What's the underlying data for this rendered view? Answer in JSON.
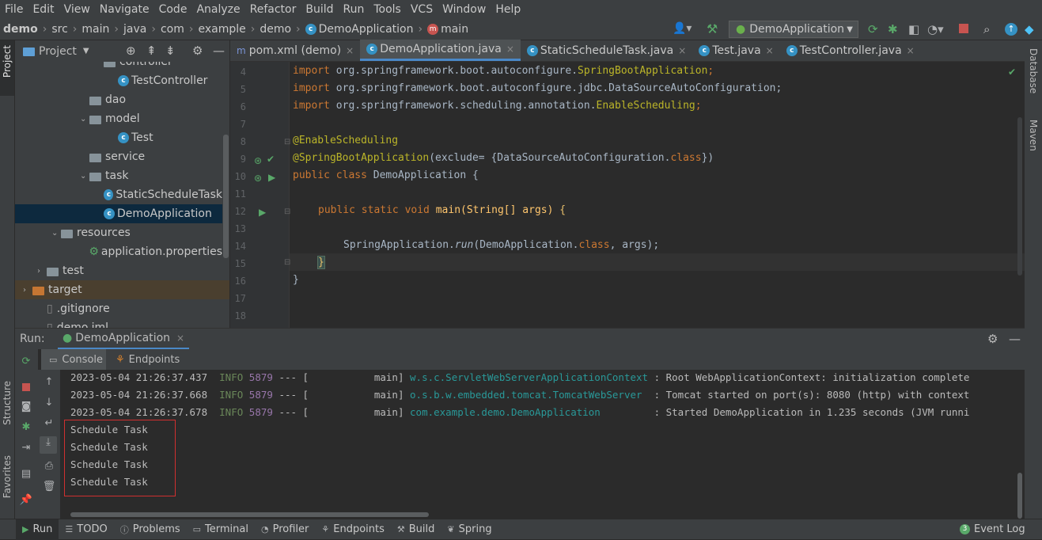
{
  "menu": [
    "File",
    "Edit",
    "View",
    "Navigate",
    "Code",
    "Analyze",
    "Refactor",
    "Build",
    "Run",
    "Tools",
    "VCS",
    "Window",
    "Help"
  ],
  "breadcrumb": [
    "demo",
    "src",
    "main",
    "java",
    "com",
    "example",
    "demo",
    "DemoApplication",
    "main"
  ],
  "run_config": "DemoApplication",
  "project": {
    "title": "Project",
    "tree": [
      {
        "label": "controller",
        "indent": 112,
        "type": "folder"
      },
      {
        "label": "TestController",
        "indent": 112,
        "type": "class"
      },
      {
        "label": "dao",
        "indent": 94,
        "type": "folder"
      },
      {
        "label": "model",
        "indent": 94,
        "type": "folder-open"
      },
      {
        "label": "Test",
        "indent": 112,
        "type": "class"
      },
      {
        "label": "service",
        "indent": 94,
        "type": "folder"
      },
      {
        "label": "task",
        "indent": 94,
        "type": "folder-open"
      },
      {
        "label": "StaticScheduleTask",
        "indent": 112,
        "type": "class"
      },
      {
        "label": "DemoApplication",
        "indent": 94,
        "type": "spring"
      },
      {
        "label": "resources",
        "indent": 58,
        "type": "folder-open"
      },
      {
        "label": "application.properties",
        "indent": 76,
        "type": "props"
      },
      {
        "label": "test",
        "indent": 40,
        "type": "folder-closed"
      },
      {
        "label": "target",
        "indent": 22,
        "type": "folder-orange"
      },
      {
        "label": ".gitignore",
        "indent": 22,
        "type": "file"
      },
      {
        "label": "demo.iml",
        "indent": 22,
        "type": "file"
      }
    ]
  },
  "tabs": [
    {
      "label": "pom.xml (demo)",
      "icon": "m"
    },
    {
      "label": "DemoApplication.java",
      "icon": "c",
      "active": true
    },
    {
      "label": "StaticScheduleTask.java",
      "icon": "c"
    },
    {
      "label": "Test.java",
      "icon": "c"
    },
    {
      "label": "TestController.java",
      "icon": "c"
    }
  ],
  "line_numbers": [
    "4",
    "5",
    "6",
    "7",
    "8",
    "9",
    "10",
    "11",
    "12",
    "13",
    "14",
    "15",
    "16",
    "17",
    "18"
  ],
  "code": {
    "l4_kw": "import ",
    "l4_pkg": "org.springframework.boot.autoconfigure.",
    "l4_an": "SpringBootApplication",
    "l4_end": ";",
    "l5_kw": "import ",
    "l5_rest": "org.springframework.boot.autoconfigure.jdbc.DataSourceAutoConfiguration;",
    "l6_kw": "import ",
    "l6_pkg": "org.springframework.scheduling.annotation.",
    "l6_an": "EnableScheduling",
    "l6_end": ";",
    "l8": "@EnableScheduling",
    "l9_an": "@SpringBootApplication",
    "l9_a": "(exclude= {DataSourceAutoConfiguration.",
    "l9_kw": "class",
    "l9_b": "})",
    "l10_kw": "public class ",
    "l10_rest": "DemoApplication {",
    "l12_kw": "public static void ",
    "l12_rest": "main(String[] args) ",
    "l12_brace": "{",
    "l14_a": "SpringApplication.",
    "l14_run": "run",
    "l14_b": "(DemoApplication.",
    "l14_kw": "class",
    "l14_c": ", args);",
    "l15": "}",
    "l16": "}"
  },
  "run_panel": {
    "label": "Run:",
    "config": "DemoApplication",
    "tabs": [
      "Console",
      "Endpoints"
    ]
  },
  "console": [
    {
      "ts": "2023-05-04 21:26:37.437",
      "level": "INFO",
      "pid": "5879",
      "mid": "--- [           main]",
      "cls": "w.s.c.ServletWebServerApplicationContext",
      "msg": " : Root WebApplicationContext: initialization complete"
    },
    {
      "ts": "2023-05-04 21:26:37.668",
      "level": "INFO",
      "pid": "5879",
      "mid": "--- [           main]",
      "cls": "o.s.b.w.embedded.tomcat.TomcatWebServer ",
      "msg": " : Tomcat started on port(s): 8080 (http) with context"
    },
    {
      "ts": "2023-05-04 21:26:37.678",
      "level": "INFO",
      "pid": "5879",
      "mid": "--- [           main]",
      "cls": "com.example.demo.DemoApplication        ",
      "msg": " : Started DemoApplication in 1.235 seconds (JVM runni"
    }
  ],
  "schedule_lines": [
    "Schedule Task",
    "Schedule Task",
    "Schedule Task",
    "Schedule Task"
  ],
  "side_tabs": {
    "left": [
      "Project",
      "Structure",
      "Favorites"
    ],
    "right": [
      "Database",
      "Maven"
    ]
  },
  "status": [
    "Run",
    "TODO",
    "Problems",
    "Terminal",
    "Profiler",
    "Endpoints",
    "Build",
    "Spring"
  ],
  "event_log": {
    "count": "3",
    "label": "Event Log"
  }
}
